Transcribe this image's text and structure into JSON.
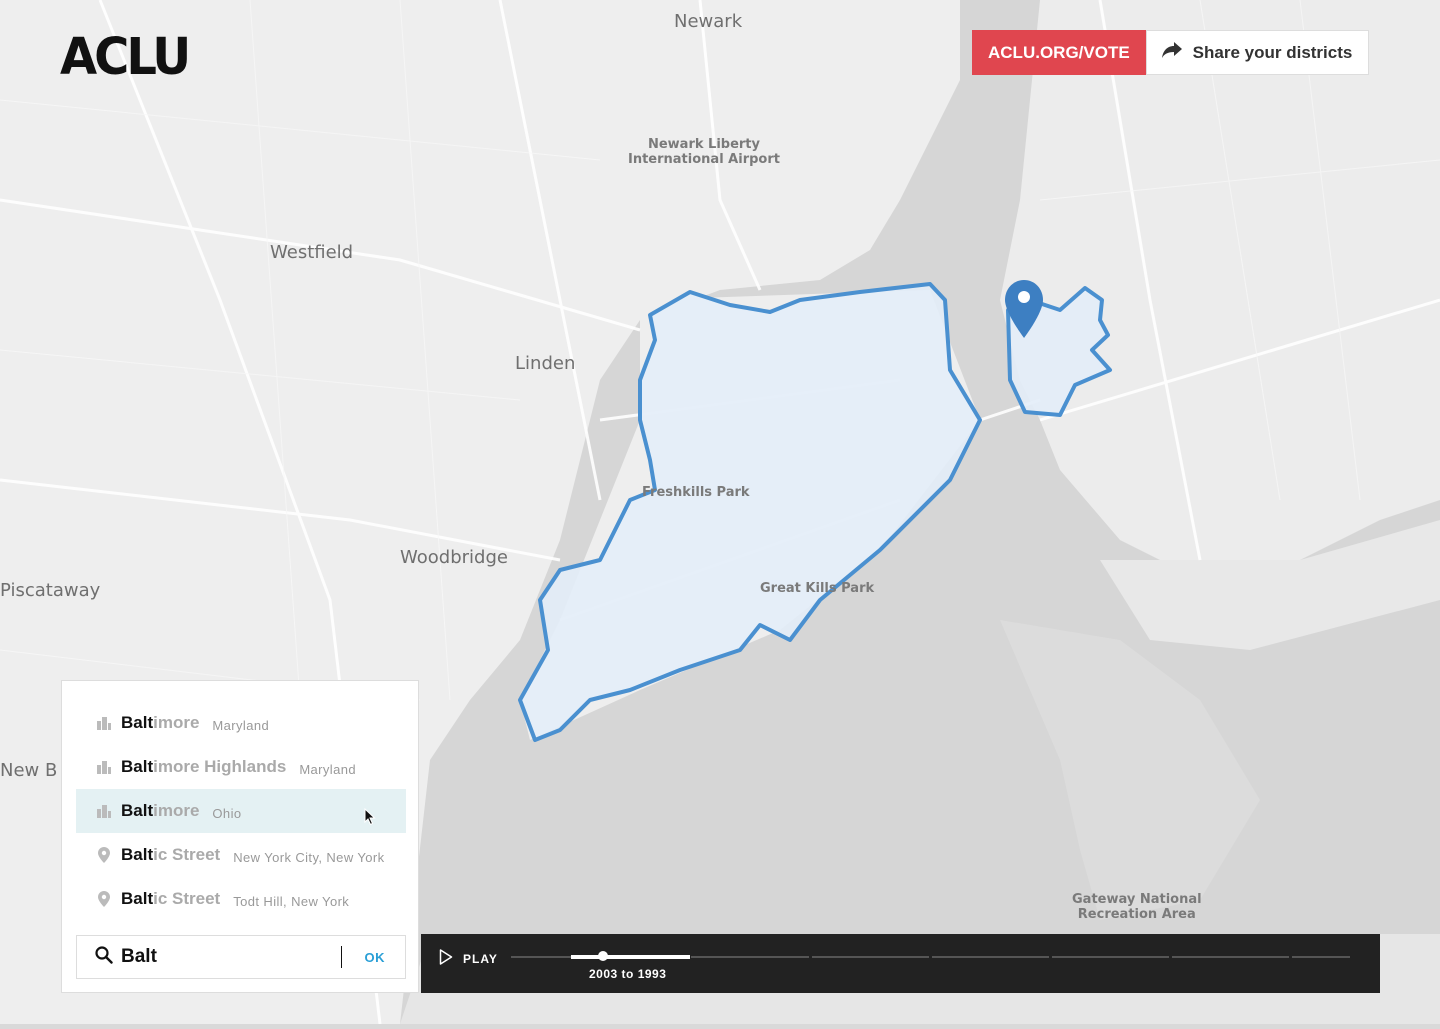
{
  "brand": {
    "logo": "ACLU"
  },
  "header": {
    "vote_label": "ACLU.ORG/VOTE",
    "share_label": "Share your districts"
  },
  "map": {
    "labels": {
      "newark": "Newark",
      "airport_line1": "Newark Liberty",
      "airport_line2": "International Airport",
      "westfield": "Westfield",
      "linden": "Linden",
      "woodbridge": "Woodbridge",
      "piscataway": "Piscataway",
      "new_b": "New B",
      "freshkills": "Freshkills Park",
      "great_kills": "Great Kills Park",
      "gateway_line1": "Gateway National",
      "gateway_line2": "Recreation Area"
    },
    "colors": {
      "district_stroke": "#4a90d0",
      "district_fill": "#e3edf8",
      "marker": "#3d7fc2"
    }
  },
  "search": {
    "query": "Balt",
    "ok_label": "OK",
    "results": [
      {
        "match": "Balt",
        "rest": "imore",
        "region": "Maryland",
        "icon": "city-icon"
      },
      {
        "match": "Balt",
        "rest": "imore Highlands",
        "region": "Maryland",
        "icon": "city-icon"
      },
      {
        "match": "Balt",
        "rest": "imore",
        "region": "Ohio",
        "icon": "city-icon"
      },
      {
        "match": "Balt",
        "rest": "ic Street",
        "region": "New York City, New York",
        "icon": "pin-icon"
      },
      {
        "match": "Balt",
        "rest": "ic Street",
        "region": "Todt Hill, New York",
        "icon": "pin-icon"
      }
    ]
  },
  "timeline": {
    "play_label": "PLAY",
    "range_label": "2003 to 1993"
  }
}
